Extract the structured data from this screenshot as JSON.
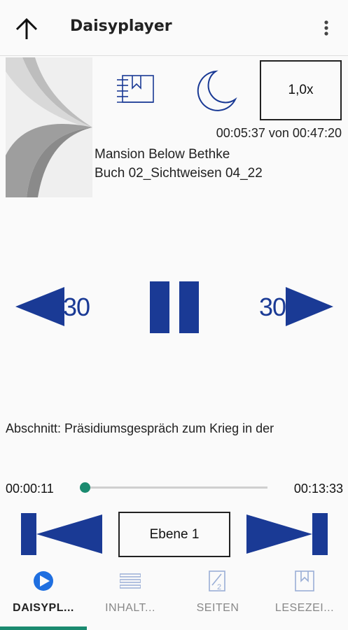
{
  "app": {
    "title": "Daisyplayer"
  },
  "icons": {
    "back": "arrow-up-icon",
    "menu": "more-vert-icon",
    "bookmark": "add-bookmark-icon",
    "sleep": "moon-icon"
  },
  "player": {
    "speed": "1,0x",
    "time_elapsed": "00:05:37",
    "time_sep": "von",
    "time_total": "00:47:20",
    "book_title": "Mansion Below Bethke",
    "chapter": "Buch 02_Sichtweisen 04_22",
    "skip_back_seconds": "30",
    "skip_forward_seconds": "30",
    "section": "Abschnitt: Präsidiumsgespräch zum Krieg in der",
    "position": "00:00:11",
    "duration": "00:13:33",
    "progress_fraction": 0.014,
    "level_label": "Ebene 1"
  },
  "nav": {
    "items": [
      {
        "label": "DAISYPL...",
        "icon": "play-circle-icon",
        "active": true
      },
      {
        "label": "INHALT...",
        "icon": "list-icon",
        "active": false
      },
      {
        "label": "SEITEN",
        "icon": "page-icon",
        "active": false
      },
      {
        "label": "LESEZEI...",
        "icon": "bookmark-icon",
        "active": false
      }
    ]
  },
  "colors": {
    "accent": "#1a8a6f",
    "control_blue": "#1a3a95",
    "nav_active": "#1f6fe0",
    "nav_inactive": "#9aaed6"
  }
}
